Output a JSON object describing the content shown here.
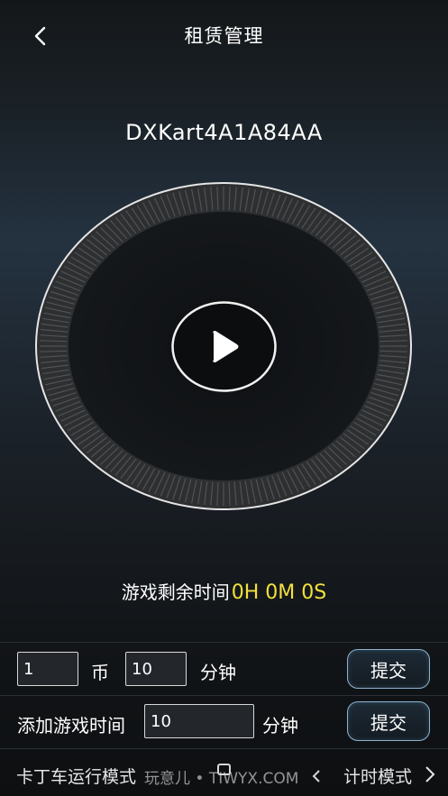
{
  "header": {
    "title": "租赁管理",
    "back_icon": "chevron-left-icon"
  },
  "device": {
    "id": "DXKart4A1A84AA"
  },
  "play": {
    "icon": "play-icon"
  },
  "timer": {
    "label": "游戏剩余时间",
    "value": "0H 0M 0S",
    "value_color": "#f2e03c"
  },
  "coin_row": {
    "coin_value": "1",
    "coin_unit": "币",
    "minutes_value": "10",
    "minutes_unit": "分钟",
    "submit_label": "提交"
  },
  "add_row": {
    "label": "添加游戏时间",
    "minutes_value": "10",
    "minutes_unit": "分钟",
    "submit_label": "提交"
  },
  "mode_bar": {
    "left_label": "卡丁车运行模式",
    "right_label": "计时模式",
    "watermark": "玩意儿 • TIWYX.COM",
    "next_icon": "chevron-right-icon"
  },
  "colors": {
    "accent_border": "#8fb2cf",
    "time_value": "#f2e03c"
  }
}
